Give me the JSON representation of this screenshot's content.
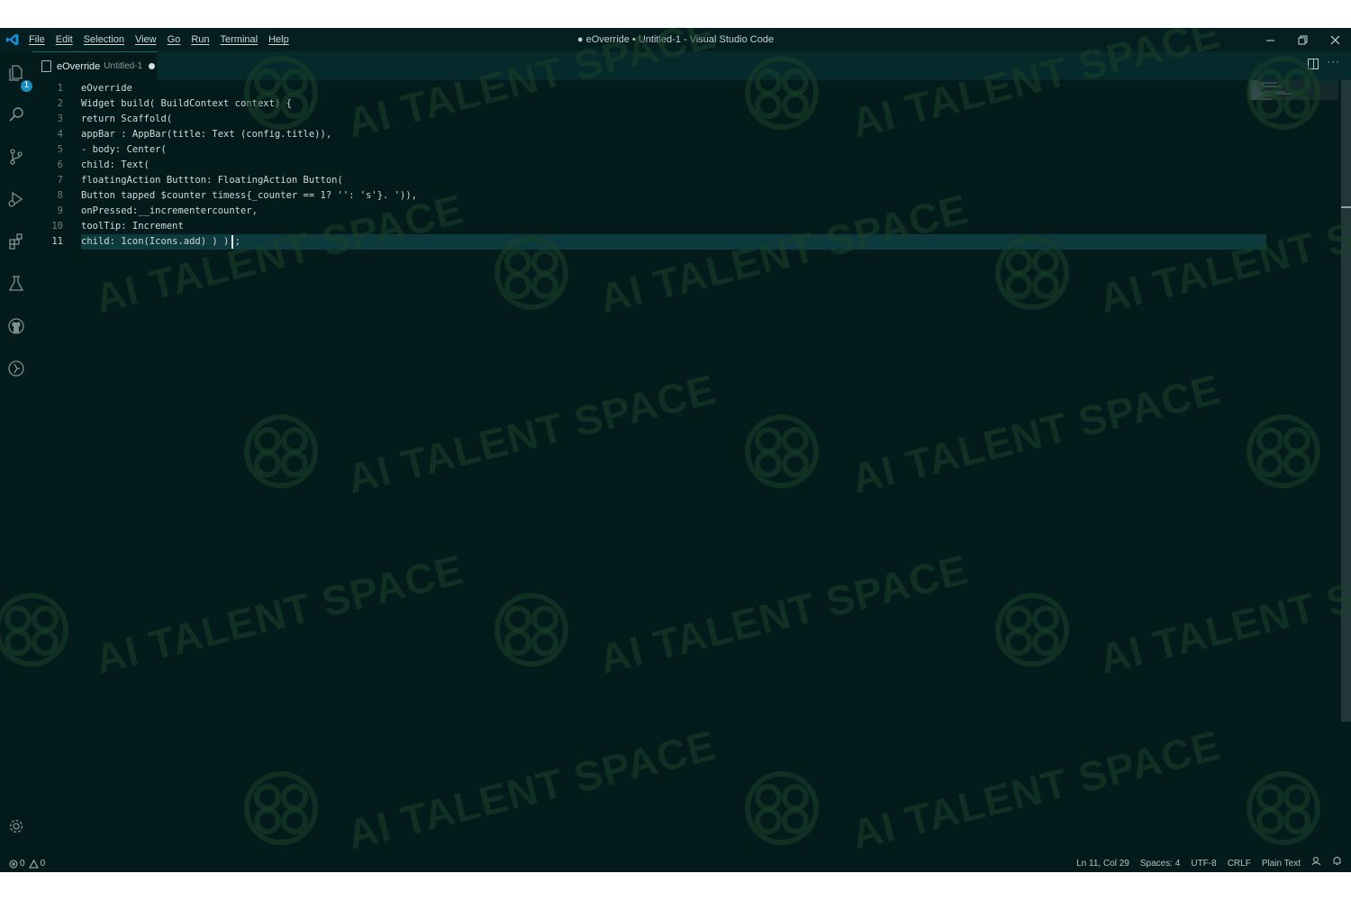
{
  "window": {
    "title": "● eOverride • Untitled-1 - Visual Studio Code"
  },
  "menu": [
    "File",
    "Edit",
    "Selection",
    "View",
    "Go",
    "Run",
    "Terminal",
    "Help"
  ],
  "tab": {
    "name": "eOverride",
    "description": "Untitled-1",
    "dirty": true
  },
  "activity_bar": {
    "items": [
      "explorer-icon",
      "search-icon",
      "source-control-icon",
      "run-debug-icon",
      "extensions-icon",
      "testing-icon",
      "github-icon",
      "remote-icon"
    ],
    "explorer_badge": "1",
    "bottom": "settings-gear-icon"
  },
  "editor": {
    "lines": [
      {
        "no": "1",
        "text": "eOverride"
      },
      {
        "no": "2",
        "text": "Widget build( BuildContext context) {"
      },
      {
        "no": "3",
        "text": "return Scaffold("
      },
      {
        "no": "4",
        "text": "appBar : AppBar(title: Text (config.title)),"
      },
      {
        "no": "5",
        "text": "- body: Center("
      },
      {
        "no": "6",
        "text": "child: Text("
      },
      {
        "no": "7",
        "text": "floatingAction Buttton: FloatingAction Button("
      },
      {
        "no": "8",
        "text": "Button tapped $counter timess{_counter == 1? '': 's'}. ')),"
      },
      {
        "no": "9",
        "text": "onPressed:__incrementercounter,"
      },
      {
        "no": "10",
        "text": "toolTip: Increment"
      },
      {
        "no": "11",
        "text": "child: 1con(Icons.add) ) ) ;"
      }
    ],
    "active_line": 11
  },
  "status_bar": {
    "errors": "0",
    "warnings": "0",
    "cursor_position": "Ln 11, Col 29",
    "indentation": "Spaces: 4",
    "encoding": "UTF-8",
    "eol": "CRLF",
    "language": "Plain Text"
  },
  "watermark": {
    "text": "AI TALENT SPACE"
  },
  "colors": {
    "background": "#041b1c",
    "accent": "#1a8fbf",
    "current_line": "#0c3a3d"
  }
}
